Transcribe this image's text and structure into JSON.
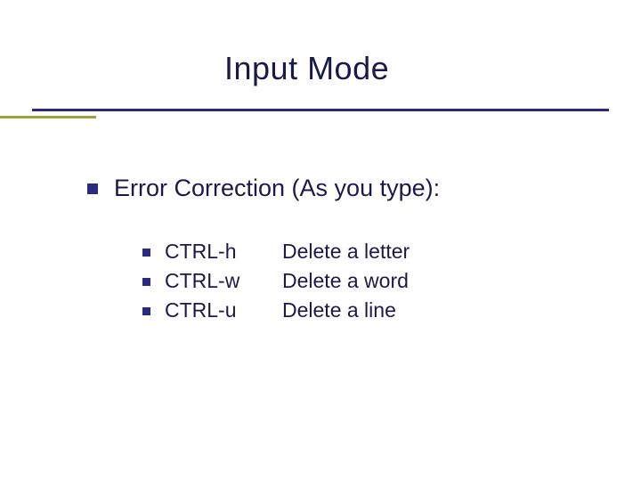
{
  "title": "Input Mode",
  "section": "Error Correction (As you type):",
  "shortcuts": [
    {
      "key": "CTRL-h",
      "desc": "Delete a letter"
    },
    {
      "key": "CTRL-w",
      "desc": "Delete a word"
    },
    {
      "key": "CTRL-u",
      "desc": "Delete a line"
    }
  ]
}
